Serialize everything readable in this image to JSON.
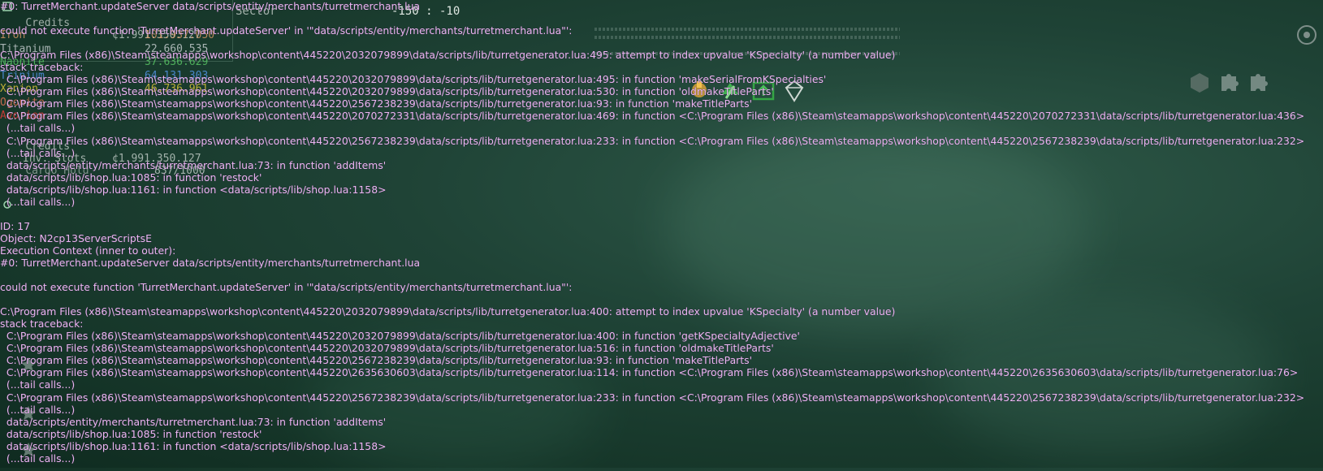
{
  "hud": {
    "credits_label": "Credits",
    "credits_value": "¢1.991.350.127",
    "sector_label": "Sector",
    "sector_coords": "-150 : -10",
    "resources": [
      {
        "label": "Iron",
        "value": "101.937.050",
        "color": "#e8a06a"
      },
      {
        "label": "Titanium",
        "value": "22.660.535",
        "color": "#d8dde0"
      },
      {
        "label": "Naonite",
        "value": "37.636.629",
        "color": "#5fd46a"
      },
      {
        "label": "Trinium",
        "value": "64.131.303",
        "color": "#5aa0ff"
      },
      {
        "label": "Xanion",
        "value": "46.736.961",
        "color": "#f0d23c"
      },
      {
        "label": "Ogonite",
        "value": "",
        "color": "#ff7a5a"
      },
      {
        "label": "Avorion",
        "value": "",
        "color": "#ff3b3b"
      }
    ],
    "credits_label_2": "Credits",
    "credits_value_2": "¢1.991.350.127",
    "slots_label": "Inv. Slots",
    "slots_value": "837/1000",
    "extra_line": "Cargo Hold",
    "counter": "17"
  },
  "log_lines": [
    "#0: TurretMerchant.updateServer data/scripts/entity/merchants/turretmerchant.lua",
    "",
    "could not execute function 'TurretMerchant.updateServer' in '\"data/scripts/entity/merchants/turretmerchant.lua\"':",
    "",
    "C:\\Program Files (x86)\\Steam\\steamapps\\workshop\\content\\445220\\2032079899\\data/scripts/lib/turretgenerator.lua:495: attempt to index upvalue 'KSpecialty' (a number value)",
    "stack traceback:",
    "  C:\\Program Files (x86)\\Steam\\steamapps\\workshop\\content\\445220\\2032079899\\data/scripts/lib/turretgenerator.lua:495: in function 'makeSerialFromKSpecialties'",
    "  C:\\Program Files (x86)\\Steam\\steamapps\\workshop\\content\\445220\\2032079899\\data/scripts/lib/turretgenerator.lua:530: in function 'oldmakeTitleParts'",
    "  C:\\Program Files (x86)\\Steam\\steamapps\\workshop\\content\\445220\\2567238239\\data/scripts/lib/turretgenerator.lua:93: in function 'makeTitleParts'",
    "  C:\\Program Files (x86)\\Steam\\steamapps\\workshop\\content\\445220\\2070272331\\data/scripts/lib/turretgenerator.lua:469: in function <C:\\Program Files (x86)\\Steam\\steamapps\\workshop\\content\\445220\\2070272331\\data/scripts/lib/turretgenerator.lua:436>",
    "  (...tail calls...)",
    "  C:\\Program Files (x86)\\Steam\\steamapps\\workshop\\content\\445220\\2567238239\\data/scripts/lib/turretgenerator.lua:233: in function <C:\\Program Files (x86)\\Steam\\steamapps\\workshop\\content\\445220\\2567238239\\data/scripts/lib/turretgenerator.lua:232>",
    "  (...tail calls...)",
    "  data/scripts/entity/merchants/turretmerchant.lua:73: in function 'addItems'",
    "  data/scripts/lib/shop.lua:1085: in function 'restock'",
    "  data/scripts/lib/shop.lua:1161: in function <data/scripts/lib/shop.lua:1158>",
    "  (...tail calls...)",
    "",
    "ID: 17",
    "Object: N2cp13ServerScriptsE",
    "Execution Context (inner to outer):",
    "#0: TurretMerchant.updateServer data/scripts/entity/merchants/turretmerchant.lua",
    "",
    "could not execute function 'TurretMerchant.updateServer' in '\"data/scripts/entity/merchants/turretmerchant.lua\"':",
    "",
    "C:\\Program Files (x86)\\Steam\\steamapps\\workshop\\content\\445220\\2032079899\\data/scripts/lib/turretgenerator.lua:400: attempt to index upvalue 'KSpecialty' (a number value)",
    "stack traceback:",
    "  C:\\Program Files (x86)\\Steam\\steamapps\\workshop\\content\\445220\\2032079899\\data/scripts/lib/turretgenerator.lua:400: in function 'getKSpecialtyAdjective'",
    "  C:\\Program Files (x86)\\Steam\\steamapps\\workshop\\content\\445220\\2032079899\\data/scripts/lib/turretgenerator.lua:516: in function 'oldmakeTitleParts'",
    "  C:\\Program Files (x86)\\Steam\\steamapps\\workshop\\content\\445220\\2567238239\\data/scripts/lib/turretgenerator.lua:93: in function 'makeTitleParts'",
    "  C:\\Program Files (x86)\\Steam\\steamapps\\workshop\\content\\445220\\2635630603\\data/scripts/lib/turretgenerator.lua:114: in function <C:\\Program Files (x86)\\Steam\\steamapps\\workshop\\content\\445220\\2635630603\\data/scripts/lib/turretgenerator.lua:76>",
    "  (...tail calls...)",
    "  C:\\Program Files (x86)\\Steam\\steamapps\\workshop\\content\\445220\\2567238239\\data/scripts/lib/turretgenerator.lua:233: in function <C:\\Program Files (x86)\\Steam\\steamapps\\workshop\\content\\445220\\2567238239\\data/scripts/lib/turretgenerator.lua:232>",
    "  (...tail calls...)",
    "  data/scripts/entity/merchants/turretmerchant.lua:73: in function 'addItems'",
    "  data/scripts/lib/shop.lua:1085: in function 'restock'",
    "  data/scripts/lib/shop.lua:1161: in function <data/scripts/lib/shop.lua:1158>",
    "  (...tail calls...)"
  ],
  "colors": {
    "log_text": "#e8b6f0",
    "background": "#1f4336"
  }
}
